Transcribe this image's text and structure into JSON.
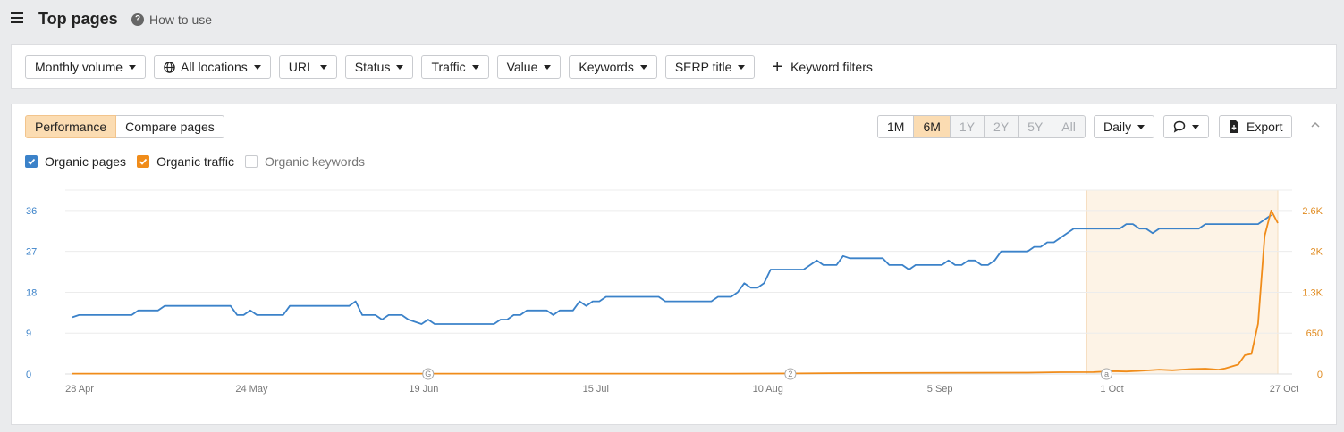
{
  "header": {
    "title": "Top pages",
    "help_label": "How to use"
  },
  "filters": {
    "monthly_volume": "Monthly volume",
    "all_locations": "All locations",
    "url": "URL",
    "status": "Status",
    "traffic": "Traffic",
    "value": "Value",
    "keywords": "Keywords",
    "serp_title": "SERP title",
    "keyword_filters": "Keyword filters"
  },
  "toolbar": {
    "performance": "Performance",
    "compare_pages": "Compare pages",
    "range": [
      "1M",
      "6M",
      "1Y",
      "2Y",
      "5Y",
      "All"
    ],
    "range_selected": "6M",
    "interval": "Daily",
    "export": "Export"
  },
  "legend": {
    "organic_pages": "Organic pages",
    "organic_traffic": "Organic traffic",
    "organic_keywords": "Organic keywords"
  },
  "colors": {
    "pages": "#3b82c9",
    "traffic": "#f08c1a",
    "accent": "#fbdcb2"
  },
  "chart_data": {
    "type": "line",
    "x_ticks": [
      "28 Apr",
      "24 May",
      "19 Jun",
      "15 Jul",
      "10 Aug",
      "5 Sep",
      "1 Oct",
      "27 Oct"
    ],
    "y_left_ticks": [
      "0",
      "9",
      "18",
      "27",
      "36"
    ],
    "y_right_ticks": [
      "0",
      "650",
      "1.3K",
      "2K",
      "2.6K"
    ],
    "y_left_range": [
      0,
      36
    ],
    "y_right_range": [
      0,
      2600
    ],
    "x_range_days": [
      0,
      183
    ],
    "highlight_days": [
      154,
      183
    ],
    "annotation_markers": [
      {
        "day": 54,
        "label": "G"
      },
      {
        "day": 109,
        "label": "2"
      },
      {
        "day": 157,
        "label": "a"
      }
    ],
    "series": [
      {
        "name": "Organic pages",
        "axis": "left",
        "points": [
          [
            0,
            12.5
          ],
          [
            1,
            13
          ],
          [
            9,
            13
          ],
          [
            10,
            14
          ],
          [
            13,
            14
          ],
          [
            14,
            15
          ],
          [
            24,
            15
          ],
          [
            25,
            13
          ],
          [
            26,
            13
          ],
          [
            27,
            14
          ],
          [
            28,
            13
          ],
          [
            32,
            13
          ],
          [
            33,
            15
          ],
          [
            42,
            15
          ],
          [
            43,
            16
          ],
          [
            44,
            13
          ],
          [
            46,
            13
          ],
          [
            47,
            12
          ],
          [
            48,
            13
          ],
          [
            50,
            13
          ],
          [
            51,
            12
          ],
          [
            53,
            11
          ],
          [
            54,
            12
          ],
          [
            55,
            11
          ],
          [
            64,
            11
          ],
          [
            65,
            12
          ],
          [
            66,
            12
          ],
          [
            67,
            13
          ],
          [
            68,
            13
          ],
          [
            69,
            14
          ],
          [
            72,
            14
          ],
          [
            73,
            13
          ],
          [
            74,
            14
          ],
          [
            76,
            14
          ],
          [
            77,
            16
          ],
          [
            78,
            15
          ],
          [
            79,
            16
          ],
          [
            80,
            16
          ],
          [
            81,
            17
          ],
          [
            89,
            17
          ],
          [
            90,
            16
          ],
          [
            97,
            16
          ],
          [
            98,
            17
          ],
          [
            100,
            17
          ],
          [
            101,
            18
          ],
          [
            102,
            20
          ],
          [
            103,
            19
          ],
          [
            104,
            19
          ],
          [
            105,
            20
          ],
          [
            106,
            23
          ],
          [
            111,
            23
          ],
          [
            112,
            24
          ],
          [
            113,
            25
          ],
          [
            114,
            24
          ],
          [
            116,
            24
          ],
          [
            117,
            26
          ],
          [
            118,
            25.5
          ],
          [
            123,
            25.5
          ],
          [
            124,
            24
          ],
          [
            126,
            24
          ],
          [
            127,
            23
          ],
          [
            128,
            24
          ],
          [
            132,
            24
          ],
          [
            133,
            25
          ],
          [
            134,
            24
          ],
          [
            135,
            24
          ],
          [
            136,
            25
          ],
          [
            137,
            25
          ],
          [
            138,
            24
          ],
          [
            139,
            24
          ],
          [
            140,
            25
          ],
          [
            141,
            27
          ],
          [
            145,
            27
          ],
          [
            146,
            28
          ],
          [
            147,
            28
          ],
          [
            148,
            29
          ],
          [
            149,
            29
          ],
          [
            152,
            32
          ],
          [
            159,
            32
          ],
          [
            160,
            33
          ],
          [
            161,
            33
          ],
          [
            162,
            32
          ],
          [
            163,
            32
          ],
          [
            164,
            31
          ],
          [
            165,
            32
          ],
          [
            171,
            32
          ],
          [
            172,
            33
          ],
          [
            179,
            33
          ],
          [
            180,
            33
          ],
          [
            182,
            35
          ]
        ]
      },
      {
        "name": "Organic traffic",
        "axis": "right",
        "points": [
          [
            0,
            5
          ],
          [
            100,
            5
          ],
          [
            110,
            8
          ],
          [
            120,
            15
          ],
          [
            135,
            20
          ],
          [
            145,
            22
          ],
          [
            150,
            28
          ],
          [
            155,
            30
          ],
          [
            158,
            45
          ],
          [
            160,
            40
          ],
          [
            162,
            50
          ],
          [
            165,
            70
          ],
          [
            167,
            60
          ],
          [
            170,
            80
          ],
          [
            172,
            85
          ],
          [
            174,
            70
          ],
          [
            175,
            90
          ],
          [
            177,
            150
          ],
          [
            178,
            300
          ],
          [
            179,
            320
          ],
          [
            180,
            800
          ],
          [
            181,
            2200
          ],
          [
            182,
            2600
          ],
          [
            183,
            2400
          ]
        ]
      }
    ]
  }
}
